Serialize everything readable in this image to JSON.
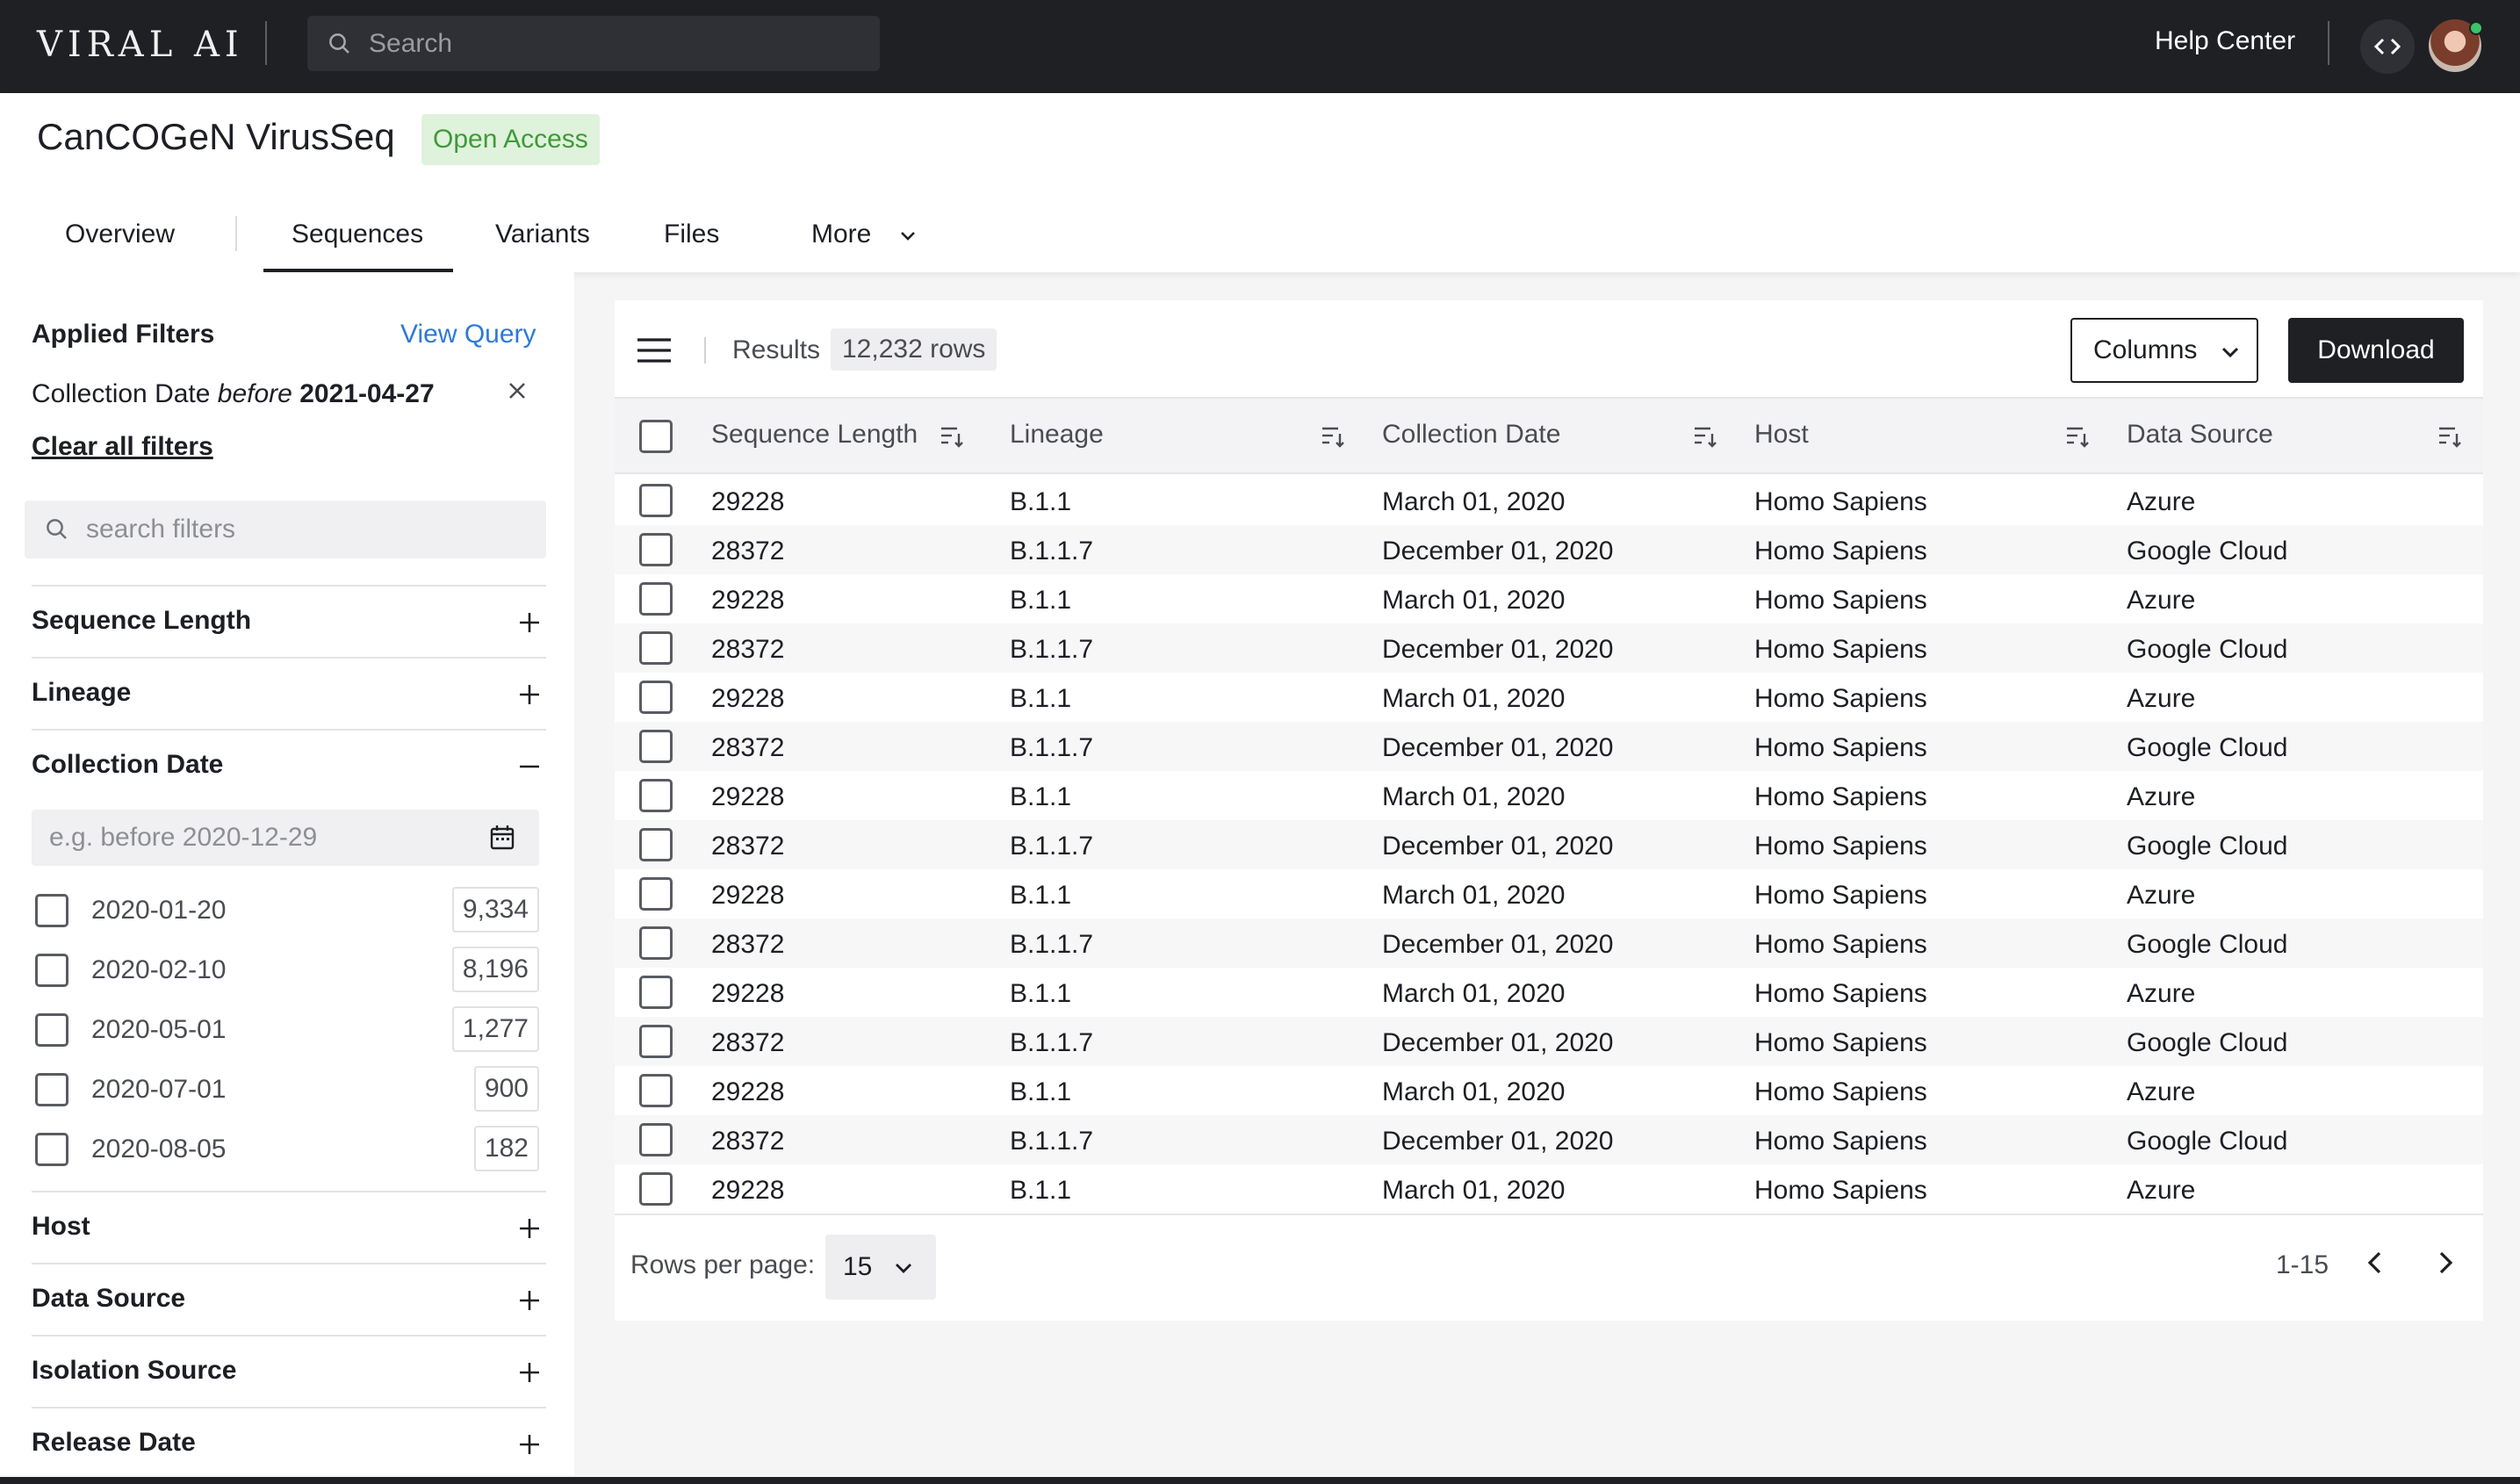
{
  "app": {
    "logo": "VIRAL AI",
    "search_placeholder": "Search",
    "help_label": "Help Center"
  },
  "header": {
    "title": "CanCOGeN VirusSeq",
    "badge": "Open Access",
    "tabs": [
      {
        "label": "Overview"
      },
      {
        "label": "Sequences",
        "active": true
      },
      {
        "label": "Variants"
      },
      {
        "label": "Files"
      },
      {
        "label": "More"
      }
    ]
  },
  "sidebar": {
    "applied_title": "Applied Filters",
    "view_query": "View Query",
    "applied_filter": {
      "field": "Collection Date",
      "op": "before",
      "value": "2021-04-27"
    },
    "clear_all": "Clear all filters",
    "search_placeholder": "search filters",
    "sections": [
      {
        "label": "Sequence Length",
        "expanded": false
      },
      {
        "label": "Lineage",
        "expanded": false
      },
      {
        "label": "Collection Date",
        "expanded": true
      },
      {
        "label": "Host",
        "expanded": false
      },
      {
        "label": "Data Source",
        "expanded": false
      },
      {
        "label": "Isolation Source",
        "expanded": false
      },
      {
        "label": "Release Date",
        "expanded": false
      }
    ],
    "date_placeholder": "e.g. before 2020-12-29",
    "date_options": [
      {
        "label": "2020-01-20",
        "count": "9,334"
      },
      {
        "label": "2020-02-10",
        "count": "8,196"
      },
      {
        "label": "2020-05-01",
        "count": "1,277"
      },
      {
        "label": "2020-07-01",
        "count": "900"
      },
      {
        "label": "2020-08-05",
        "count": "182"
      }
    ]
  },
  "results": {
    "label": "Results",
    "count": "12,232 rows",
    "columns_button": "Columns",
    "download_button": "Download",
    "headers": [
      "Sequence Length",
      "Lineage",
      "Collection Date",
      "Host",
      "Data Source"
    ],
    "rows": [
      [
        "29228",
        "B.1.1",
        "March 01, 2020",
        "Homo Sapiens",
        "Azure"
      ],
      [
        "28372",
        "B.1.1.7",
        "December 01, 2020",
        "Homo Sapiens",
        "Google Cloud"
      ],
      [
        "29228",
        "B.1.1",
        "March 01, 2020",
        "Homo Sapiens",
        "Azure"
      ],
      [
        "28372",
        "B.1.1.7",
        "December 01, 2020",
        "Homo Sapiens",
        "Google Cloud"
      ],
      [
        "29228",
        "B.1.1",
        "March 01, 2020",
        "Homo Sapiens",
        "Azure"
      ],
      [
        "28372",
        "B.1.1.7",
        "December 01, 2020",
        "Homo Sapiens",
        "Google Cloud"
      ],
      [
        "29228",
        "B.1.1",
        "March 01, 2020",
        "Homo Sapiens",
        "Azure"
      ],
      [
        "28372",
        "B.1.1.7",
        "December 01, 2020",
        "Homo Sapiens",
        "Google Cloud"
      ],
      [
        "29228",
        "B.1.1",
        "March 01, 2020",
        "Homo Sapiens",
        "Azure"
      ],
      [
        "28372",
        "B.1.1.7",
        "December 01, 2020",
        "Homo Sapiens",
        "Google Cloud"
      ],
      [
        "29228",
        "B.1.1",
        "March 01, 2020",
        "Homo Sapiens",
        "Azure"
      ],
      [
        "28372",
        "B.1.1.7",
        "December 01, 2020",
        "Homo Sapiens",
        "Google Cloud"
      ],
      [
        "29228",
        "B.1.1",
        "March 01, 2020",
        "Homo Sapiens",
        "Azure"
      ],
      [
        "28372",
        "B.1.1.7",
        "December 01, 2020",
        "Homo Sapiens",
        "Google Cloud"
      ],
      [
        "29228",
        "B.1.1",
        "March 01, 2020",
        "Homo Sapiens",
        "Azure"
      ]
    ],
    "rows_per_page_label": "Rows per page:",
    "rows_per_page": "15",
    "page_range": "1-15"
  },
  "icons": {
    "search": "search-icon",
    "code": "code-icon",
    "close": "close-icon",
    "plus": "plus-icon",
    "minus": "minus-icon",
    "calendar": "calendar-icon",
    "menu": "hamburger-menu-icon",
    "sort": "sort-icon",
    "chevron_down": "chevron-down-icon",
    "chevron_left": "chevron-left-icon",
    "chevron_right": "chevron-right-icon"
  },
  "colors": {
    "topbar": "#1e2024",
    "accent_link": "#2d7ad6",
    "badge_bg": "#dff2dc",
    "badge_text": "#3f9a39"
  }
}
